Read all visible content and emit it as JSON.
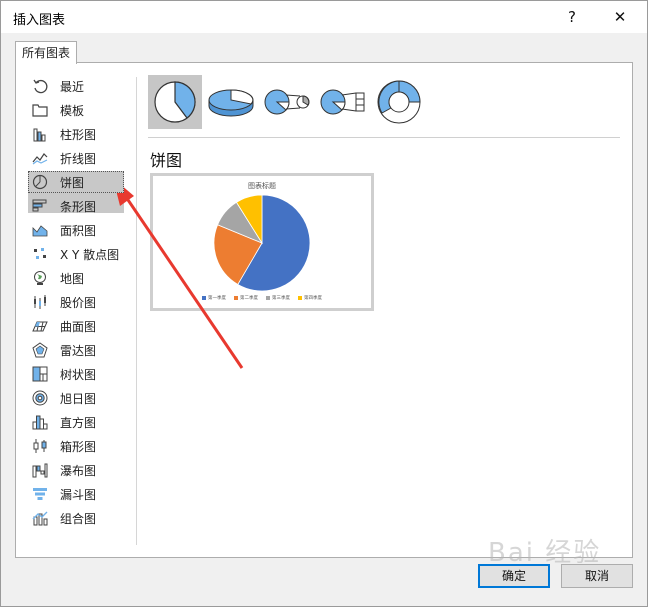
{
  "dialog": {
    "title": "插入图表",
    "help_label": "?",
    "close_label": "✕"
  },
  "tab": {
    "label": "所有图表"
  },
  "categories": [
    {
      "label": "最近",
      "icon": "recent-icon"
    },
    {
      "label": "模板",
      "icon": "folder-icon"
    },
    {
      "label": "柱形图",
      "icon": "column-chart-icon"
    },
    {
      "label": "折线图",
      "icon": "line-chart-icon"
    },
    {
      "label": "饼图",
      "icon": "pie-chart-icon",
      "selected": true
    },
    {
      "label": "条形图",
      "icon": "bar-chart-icon"
    },
    {
      "label": "面积图",
      "icon": "area-chart-icon"
    },
    {
      "label": "X Y 散点图",
      "icon": "scatter-chart-icon"
    },
    {
      "label": "地图",
      "icon": "map-chart-icon"
    },
    {
      "label": "股价图",
      "icon": "stock-chart-icon"
    },
    {
      "label": "曲面图",
      "icon": "surface-chart-icon"
    },
    {
      "label": "雷达图",
      "icon": "radar-chart-icon"
    },
    {
      "label": "树状图",
      "icon": "treemap-chart-icon"
    },
    {
      "label": "旭日图",
      "icon": "sunburst-chart-icon"
    },
    {
      "label": "直方图",
      "icon": "histogram-chart-icon"
    },
    {
      "label": "箱形图",
      "icon": "box-whisker-chart-icon"
    },
    {
      "label": "瀑布图",
      "icon": "waterfall-chart-icon"
    },
    {
      "label": "漏斗图",
      "icon": "funnel-chart-icon"
    },
    {
      "label": "组合图",
      "icon": "combo-chart-icon"
    }
  ],
  "subtypes": [
    {
      "icon": "pie-subtype-icon",
      "selected": true
    },
    {
      "icon": "3d-pie-subtype-icon"
    },
    {
      "icon": "pie-of-pie-subtype-icon"
    },
    {
      "icon": "bar-of-pie-subtype-icon"
    },
    {
      "icon": "doughnut-subtype-icon"
    }
  ],
  "main": {
    "heading": "饼图"
  },
  "chart_data": {
    "type": "pie",
    "title": "图表标题",
    "categories": [
      "第一季度",
      "第二季度",
      "第三季度",
      "第四季度"
    ],
    "values": [
      59,
      23,
      10,
      9
    ],
    "colors": [
      "#4472c4",
      "#ed7d31",
      "#a5a5a5",
      "#ffc000"
    ],
    "legend": "bottom"
  },
  "buttons": {
    "ok_label": "确定",
    "cancel_label": "取消"
  },
  "colors": {
    "accent": "#0078d7",
    "pie_blue": "#71b2ea",
    "arrow_red": "#e8392f"
  },
  "watermark": {
    "text": "Bai 经验"
  }
}
